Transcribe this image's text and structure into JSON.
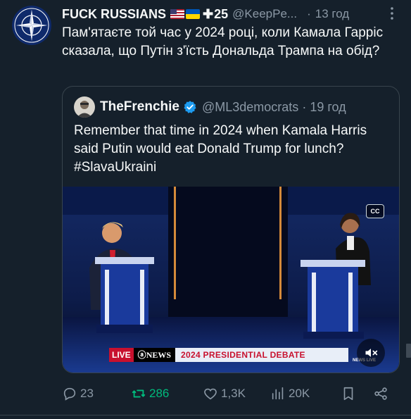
{
  "tweet": {
    "author": {
      "display_name": "FUCK RUSSIANS",
      "badge_count": "25",
      "handle": "@KeepPe...",
      "time": "13 год",
      "avatar_icon": "nato-star-icon"
    },
    "text": "Пам'ятаєте той час у 2024 році, коли Камала Гарріс сказала, що Путін з'їсть Дональда Трампа на обід?",
    "quote": {
      "display_name": "TheFrenchie",
      "handle": "@ML3democrats",
      "time": "19 год",
      "text": "Remember that time in 2024 when Kamala Harris said Putin would eat Donald Trump for lunch? #SlavaUkraini",
      "video": {
        "cc_label": "CC",
        "live_label": "LIVE",
        "network_label": "NEWS",
        "banner_title": "2024 PRESIDENTIAL DEBATE",
        "bug_label": "NEWS LIVE"
      }
    },
    "actions": {
      "replies": "23",
      "reposts": "286",
      "likes": "1,3K",
      "views": "20K"
    }
  },
  "colors": {
    "background": "#15202b",
    "text_primary": "#f7f9f9",
    "text_secondary": "#8b98a5",
    "border": "#38444d",
    "repost_active": "#00ba7c",
    "verified": "#1d9bf0"
  }
}
